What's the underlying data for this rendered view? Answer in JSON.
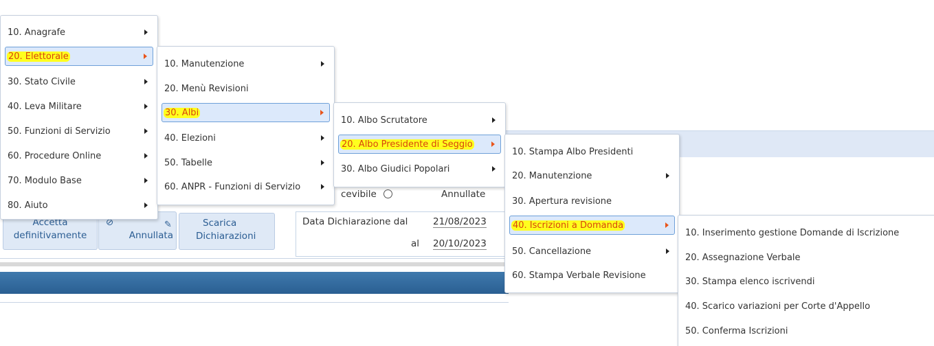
{
  "background": {
    "visible_label_partial": "cevibile",
    "annullate_label": "Annullate",
    "buttons": {
      "accetta_line1": "Accetta",
      "accetta_line2": "definitivamente",
      "annullata_icon": "⊘",
      "annullata": "Annullata",
      "scarica_line1": "Scarica",
      "scarica_line2": "Dichiarazioni"
    },
    "filter": {
      "from_label": "Data Dichiarazione dal",
      "from_value": "21/08/2023",
      "to_label": "al",
      "to_value": "20/10/2023"
    }
  },
  "menus": {
    "level1": [
      {
        "label": "10. Anagrafe",
        "submenu": true
      },
      {
        "label": "20. Elettorale",
        "submenu": true,
        "selected": true
      },
      {
        "label": "30. Stato Civile",
        "submenu": true
      },
      {
        "label": "40. Leva Militare",
        "submenu": true
      },
      {
        "label": "50. Funzioni di Servizio",
        "submenu": true
      },
      {
        "label": "60. Procedure Online",
        "submenu": true
      },
      {
        "label": "70. Modulo Base",
        "submenu": true
      },
      {
        "label": "80. Aiuto",
        "submenu": true
      }
    ],
    "level2": [
      {
        "label": "10. Manutenzione",
        "submenu": true
      },
      {
        "label": "20. Menù Revisioni",
        "submenu": false
      },
      {
        "label": "30. Albi",
        "submenu": true,
        "selected": true
      },
      {
        "label": "40. Elezioni",
        "submenu": true
      },
      {
        "label": "50. Tabelle",
        "submenu": true
      },
      {
        "label": "60. ANPR - Funzioni di Servizio",
        "submenu": true
      }
    ],
    "level3": [
      {
        "label": "10. Albo Scrutatore",
        "submenu": true
      },
      {
        "label": "20. Albo Presidente di Seggio",
        "submenu": true,
        "selected": true
      },
      {
        "label": "30. Albo Giudici Popolari",
        "submenu": true
      }
    ],
    "level4": [
      {
        "label": "10. Stampa Albo Presidenti",
        "submenu": false
      },
      {
        "label": "20. Manutenzione",
        "submenu": true
      },
      {
        "label": "30. Apertura revisione",
        "submenu": false
      },
      {
        "label": "40. Iscrizioni a Domanda",
        "submenu": true,
        "selected": true
      },
      {
        "label": "50. Cancellazione",
        "submenu": true
      },
      {
        "label": "60. Stampa Verbale Revisione",
        "submenu": false
      }
    ],
    "level5": [
      {
        "label": "10. Inserimento gestione Domande di Iscrizione",
        "submenu": false
      },
      {
        "label": "20. Assegnazione Verbale",
        "submenu": false
      },
      {
        "label": "30. Stampa elenco iscrivendi",
        "submenu": false
      },
      {
        "label": "40. Scarico variazioni per Corte d'Appello",
        "submenu": false
      },
      {
        "label": "50. Conferma Iscrizioni",
        "submenu": false
      }
    ]
  },
  "colors": {
    "highlight": "#ffff1e",
    "selected_text": "#d8440c",
    "selected_bg": "#dce9fb"
  }
}
